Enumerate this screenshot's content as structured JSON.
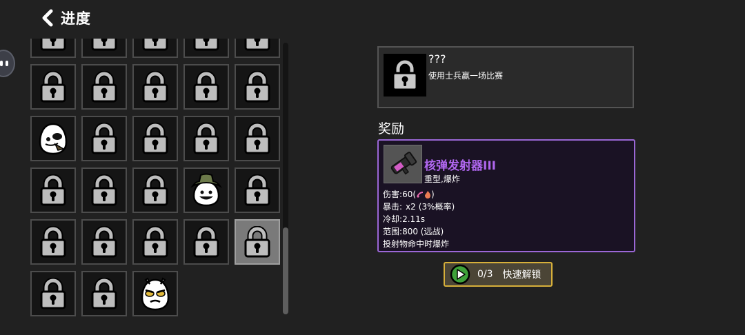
{
  "header": {
    "title": "进度"
  },
  "grid": {
    "cells": [
      "lock",
      "lock",
      "lock",
      "lock",
      "lock",
      "lock",
      "lock",
      "lock",
      "lock",
      "lock",
      "skull-ghost",
      "lock",
      "lock",
      "lock",
      "lock",
      "lock",
      "lock",
      "lock",
      "hat-ghost",
      "lock",
      "lock",
      "lock",
      "lock",
      "lock",
      "lock-selected",
      "lock",
      "lock",
      "angry-ghost"
    ],
    "selected_index": 24
  },
  "achievement": {
    "name": "???",
    "description": "使用士兵赢一场比赛",
    "icon": "lock-icon"
  },
  "reward": {
    "section_title": "奖励",
    "weapon_name": "核弹发射器III",
    "weapon_type": "重型,爆炸",
    "weapon_icon": "rocket-launcher-icon",
    "name_color": "#b067ef",
    "border_color": "#9b67d6",
    "stats": {
      "damage_label": "伤害",
      "damage_sep": ":",
      "damage_value": "60(",
      "damage_close": ")",
      "crit_label": "暴击:",
      "crit_value": "x2",
      "crit_chance": "(3%概率)",
      "cooldown_label": "冷却",
      "cooldown_sep": ":",
      "cooldown_value": "2.11s",
      "range_label": "范围",
      "range_sep": ":",
      "range_value": "800 (远战)",
      "effect": "投射物命中时爆炸"
    }
  },
  "unlock_button": {
    "count": "0/3",
    "label": "快速解锁",
    "icon": "play-icon",
    "border_color": "#d7b03a"
  }
}
